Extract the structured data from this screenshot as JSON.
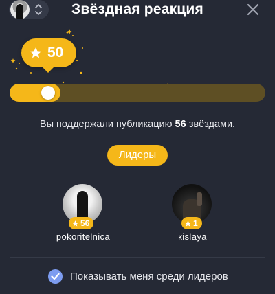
{
  "header": {
    "title": "Звёздная реакция",
    "close_icon": "close-icon",
    "account_chevron_icon": "chevron-up-down-icon"
  },
  "rating": {
    "stars_selected": "50",
    "icon": "star-icon",
    "slider_fraction": 0.2
  },
  "summary": {
    "prefix": "Вы поддержали публикацию ",
    "count": "56",
    "suffix": " звёздами."
  },
  "leaders_button_label": "Лидеры",
  "leaders": [
    {
      "name": "pokoritelnica",
      "stars": "56"
    },
    {
      "name": "кislaya",
      "stars": "1"
    }
  ],
  "show_in_leaders": {
    "label": "Показывать меня среди лидеров",
    "checked": true
  },
  "colors": {
    "background": "#252935",
    "accent": "#f5b719",
    "track": "#5e4f24",
    "checkbox": "#7d9cf0"
  }
}
